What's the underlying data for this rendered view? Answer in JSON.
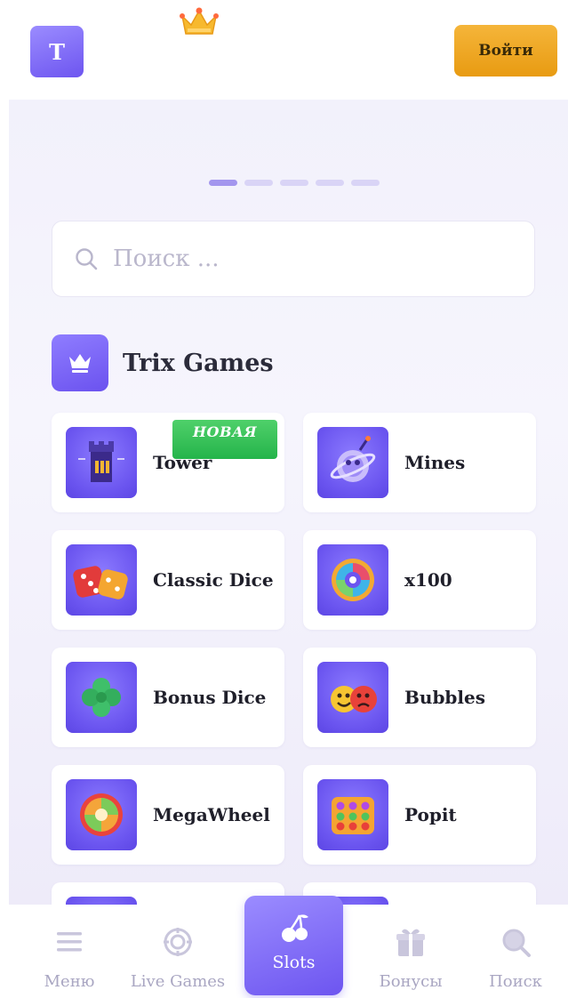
{
  "header": {
    "logo_letter": "T",
    "login_label": "Войти"
  },
  "search": {
    "placeholder": "Поиск ..."
  },
  "section": {
    "title": "Trix Games"
  },
  "games": [
    {
      "label": "Tower",
      "badge": "НОВАЯ"
    },
    {
      "label": "Mines"
    },
    {
      "label": "Classic Dice"
    },
    {
      "label": "x100"
    },
    {
      "label": "Bonus Dice"
    },
    {
      "label": "Bubbles"
    },
    {
      "label": "MegaWheel"
    },
    {
      "label": "Popit"
    }
  ],
  "nav": {
    "menu": "Меню",
    "live": "Live Games",
    "slots": "Slots",
    "bonuses": "Бонусы",
    "search": "Поиск"
  },
  "colors": {
    "accent": "#7b65f5",
    "login": "#f0a726",
    "badge": "#2fbf52"
  }
}
